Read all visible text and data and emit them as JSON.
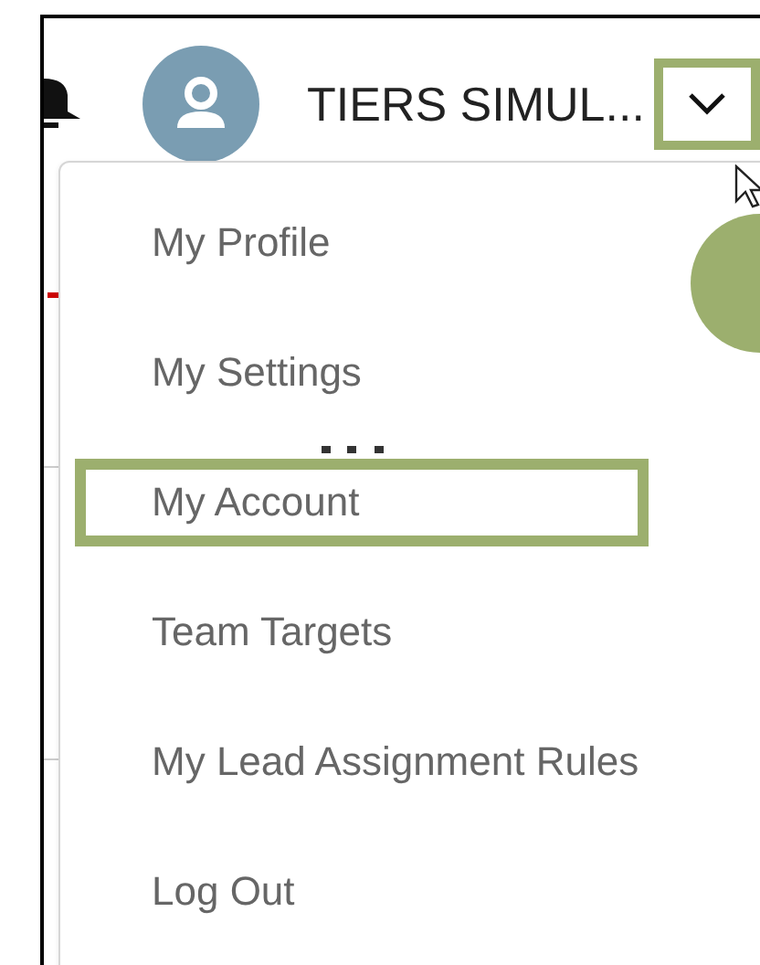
{
  "header": {
    "user_name": "TIERS SIMUL...",
    "dropdown_highlighted": true,
    "menu_expanded": true
  },
  "menu": {
    "items": [
      {
        "label": "My Profile",
        "highlighted": false
      },
      {
        "label": "My Settings",
        "highlighted": false
      },
      {
        "label": "My Account",
        "highlighted": true
      },
      {
        "label": "Team Targets",
        "highlighted": false
      },
      {
        "label": "My Lead Assignment Rules",
        "highlighted": false
      },
      {
        "label": "Log Out",
        "highlighted": false
      }
    ]
  }
}
